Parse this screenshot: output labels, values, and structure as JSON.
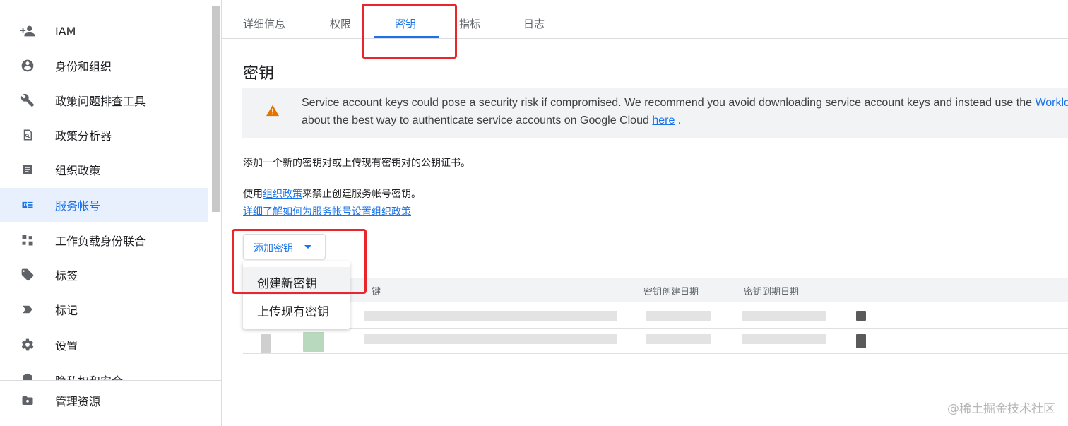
{
  "sidebar": {
    "items": [
      {
        "label": "IAM",
        "icon": "person-add-icon"
      },
      {
        "label": "身份和组织",
        "icon": "account-circle-icon"
      },
      {
        "label": "政策问题排查工具",
        "icon": "wrench-icon"
      },
      {
        "label": "政策分析器",
        "icon": "policy-analyzer-icon"
      },
      {
        "label": "组织政策",
        "icon": "document-icon"
      },
      {
        "label": "服务帐号",
        "icon": "service-account-icon"
      },
      {
        "label": "工作负载身份联合",
        "icon": "workload-identity-icon"
      },
      {
        "label": "标签",
        "icon": "tag-icon"
      },
      {
        "label": "标记",
        "icon": "label-icon"
      },
      {
        "label": "设置",
        "icon": "gear-icon"
      },
      {
        "label": "隐私权和安全",
        "icon": "shield-icon"
      }
    ],
    "active_index": 5,
    "footer": {
      "label": "管理资源",
      "icon": "manage-resources-icon"
    }
  },
  "tabs": [
    {
      "label": "详细信息"
    },
    {
      "label": "权限"
    },
    {
      "label": "密钥"
    },
    {
      "label": "指标"
    },
    {
      "label": "日志"
    }
  ],
  "active_tab": "密钥",
  "page": {
    "title": "密钥",
    "warning": {
      "line1_text": "Service account keys could pose a security risk if compromised. We recommend you avoid downloading service account keys and instead use the ",
      "line1_link": "Worklo",
      "line2_text": "about the best way to authenticate service accounts on Google Cloud ",
      "line2_link": "here",
      "line2_end": " ."
    },
    "description": "添加一个新的密钥对或上传现有密钥对的公钥证书。",
    "policy_prefix": "使用",
    "policy_link": "组织政策",
    "policy_suffix": "来禁止创建服务帐号密钥。",
    "learn_more_link": "详细了解如何为服务帐号设置组织政策"
  },
  "add_key_button": {
    "label": "添加密钥"
  },
  "dropdown": {
    "items": [
      "创建新密钥",
      "上传现有密钥"
    ]
  },
  "table": {
    "headers": [
      "键",
      "密钥创建日期",
      "密钥到期日期"
    ]
  },
  "watermark": "@稀土掘金技术社区",
  "colors": {
    "accent": "#1a73e8",
    "highlight_box": "#e8262c",
    "warning": "#e37400"
  }
}
